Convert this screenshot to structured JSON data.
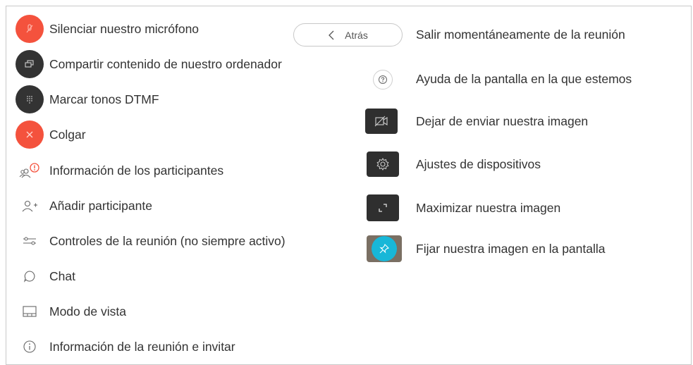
{
  "left_items": [
    {
      "label": "Silenciar nuestro micrófono",
      "icon": "mute-mic-icon"
    },
    {
      "label": "Compartir contenido de nuestro ordenador",
      "icon": "share-screen-icon"
    },
    {
      "label": "Marcar tonos DTMF",
      "icon": "dialpad-icon"
    },
    {
      "label": "Colgar",
      "icon": "hang-up-icon"
    },
    {
      "label": "Información de los participantes",
      "icon": "participants-alert-icon"
    },
    {
      "label": "Añadir participante",
      "icon": "add-person-icon"
    },
    {
      "label": "Controles de la reunión (no siempre activo)",
      "icon": "meeting-controls-icon"
    },
    {
      "label": "Chat",
      "icon": "chat-icon"
    },
    {
      "label": "Modo de vista",
      "icon": "layout-view-icon"
    },
    {
      "label": "Información de la reunión e invitar",
      "icon": "info-icon"
    }
  ],
  "back_button": {
    "label": "Atrás",
    "icon": "chevron-left-icon"
  },
  "right_items": [
    {
      "label": "Salir momentáneamente de la reunión"
    },
    {
      "label": "Ayuda de la pantalla en la que estemos",
      "icon": "help-icon"
    },
    {
      "label": "Dejar de enviar nuestra imagen",
      "icon": "camera-off-icon"
    },
    {
      "label": "Ajustes de dispositivos",
      "icon": "gear-icon"
    },
    {
      "label": "Maximizar nuestra imagen",
      "icon": "maximize-icon"
    },
    {
      "label": "Fijar nuestra imagen en la pantalla",
      "icon": "pin-icon"
    }
  ],
  "colors": {
    "danger": "#f4523d",
    "dark": "#333333",
    "accent": "#18b7d8",
    "text": "#333333"
  }
}
